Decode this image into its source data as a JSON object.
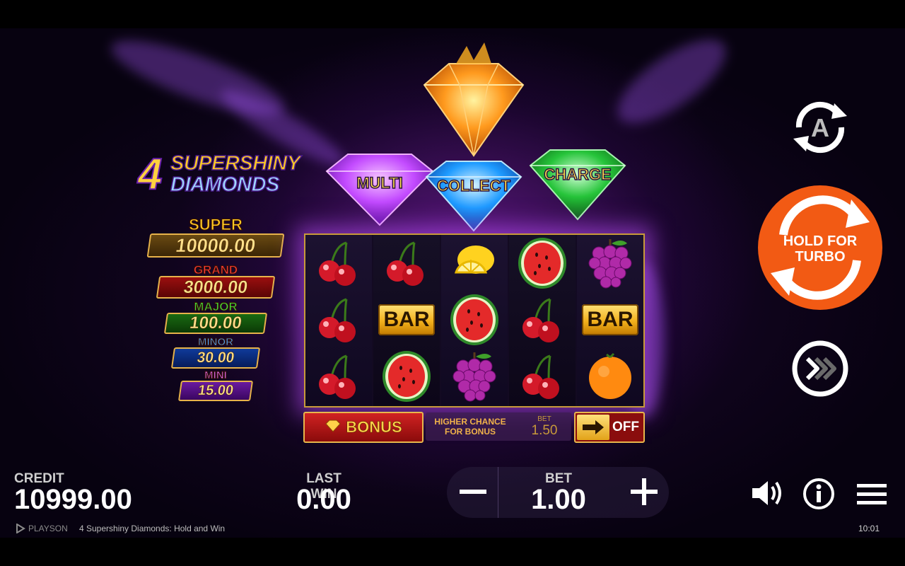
{
  "game": {
    "title": "4 Supershiny Diamonds: Hold and Win",
    "brand": "PLAYSON",
    "clock": "10:01"
  },
  "logo": {
    "number": "4",
    "line1": "SUPERSHINY",
    "line2": "DIAMONDS"
  },
  "jackpots": [
    {
      "name": "SUPER",
      "value": "10000.00",
      "color": "#ffc925"
    },
    {
      "name": "GRAND",
      "value": "3000.00",
      "color": "#ff3b3b"
    },
    {
      "name": "MAJOR",
      "value": "100.00",
      "color": "#3fe03f"
    },
    {
      "name": "MINOR",
      "value": "30.00",
      "color": "#2f8cff"
    },
    {
      "name": "MINI",
      "value": "15.00",
      "color": "#d24dff"
    }
  ],
  "diamonds": [
    {
      "label": "MULTI",
      "color": "#c34bff"
    },
    {
      "label": "COLLECT",
      "color": "#1e9bff"
    },
    {
      "label": "CHARGE",
      "color": "#26c43a"
    },
    {
      "label": "",
      "color": "#ff9a1e"
    }
  ],
  "reels": [
    [
      "cherry",
      "cherry",
      "cherry"
    ],
    [
      "cherry",
      "bar",
      "watermelon"
    ],
    [
      "lemon",
      "watermelon",
      "grapes"
    ],
    [
      "watermelon",
      "cherry",
      "cherry"
    ],
    [
      "grapes",
      "bar",
      "orange"
    ]
  ],
  "symbols": {
    "bar_text": "BAR"
  },
  "bonus_row": {
    "bonus_label": "BONUS",
    "higher_chance": "HIGHER CHANCE FOR BONUS",
    "bet_label": "BET",
    "bet_value": "1.50",
    "toggle_state": "OFF"
  },
  "controls": {
    "autoplay_letter": "A",
    "spin_label": "HOLD FOR TURBO",
    "spin_color": "#f25a14"
  },
  "bottom": {
    "credit_label": "CREDIT",
    "credit_value": "10999.00",
    "lastwin_label": "LAST WIN",
    "lastwin_value": "0.00",
    "bet_label": "BET",
    "bet_value": "1.00",
    "minus": "−",
    "plus": "+"
  }
}
